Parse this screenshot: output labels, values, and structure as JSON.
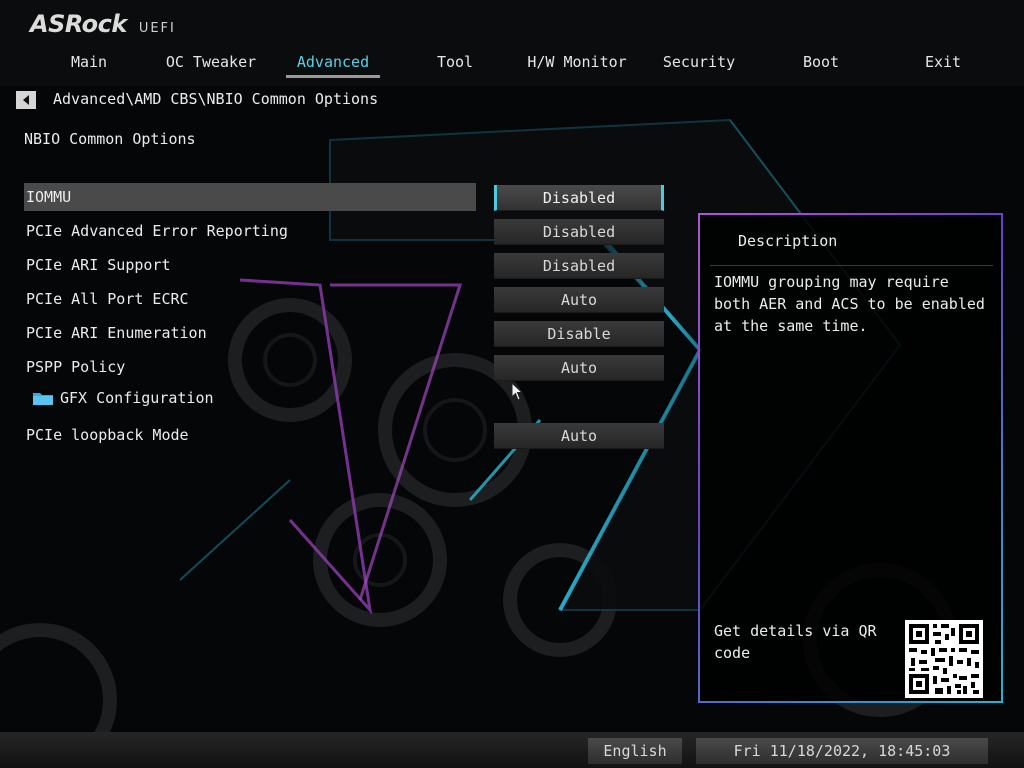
{
  "logo": {
    "brand": "ASRock",
    "sub": "UEFI"
  },
  "tabs": [
    {
      "label": "Main"
    },
    {
      "label": "OC Tweaker"
    },
    {
      "label": "Advanced"
    },
    {
      "label": "Tool"
    },
    {
      "label": "H/W Monitor"
    },
    {
      "label": "Security"
    },
    {
      "label": "Boot"
    },
    {
      "label": "Exit"
    }
  ],
  "active_tab": "Advanced",
  "breadcrumb": "Advanced\\AMD CBS\\NBIO Common Options",
  "page_title": "NBIO Common Options",
  "options": [
    {
      "label": "IOMMU",
      "value": "Disabled"
    },
    {
      "label": "PCIe Advanced Error Reporting",
      "value": "Disabled"
    },
    {
      "label": "PCIe ARI Support",
      "value": "Disabled"
    },
    {
      "label": "PCIe All Port ECRC",
      "value": "Auto"
    },
    {
      "label": "PCIe ARI Enumeration",
      "value": "Disable"
    },
    {
      "label": "PSPP Policy",
      "value": "Auto"
    },
    {
      "label": "GFX Configuration"
    },
    {
      "label": "PCIe loopback Mode",
      "value": "Auto"
    }
  ],
  "description": {
    "title": "Description",
    "text": "IOMMU grouping may require both AER and ACS to be enabled at the same time.",
    "qr_text": "Get details via QR code"
  },
  "footer": {
    "language": "English",
    "datetime": "Fri 11/18/2022, 18:45:03"
  },
  "colors": {
    "accent": "#5ad0e6",
    "panel_border_start": "#b054d8",
    "panel_border_end": "#2ab0d0",
    "background": "#050607"
  },
  "icons": {
    "back": "left-arrow-icon",
    "folder": "folder-icon",
    "cursor": "mouse-pointer-icon"
  }
}
